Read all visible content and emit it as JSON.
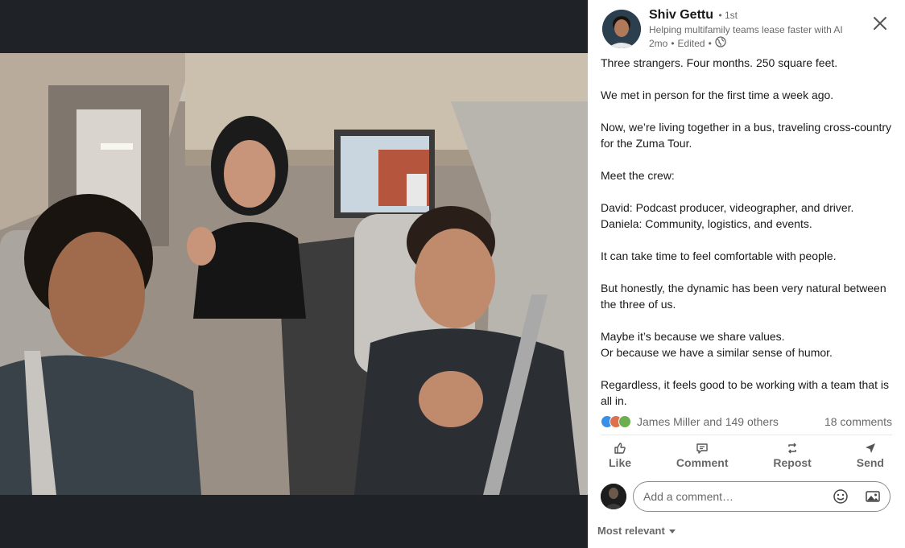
{
  "post": {
    "author": {
      "name": "Shiv Gettu",
      "degree": "• 1st",
      "headline": "Helping multifamily teams lease faster with AI",
      "time": "2mo",
      "edited": "Edited",
      "sep1": "•",
      "sep2": "•"
    },
    "text": {
      "p1": "Three strangers. Four months. 250 square feet.",
      "p2": "We met in person for the first time a week ago.",
      "p3": "Now, we’re living together in a bus, traveling cross-country for the Zuma Tour.",
      "p4": "Meet the crew:",
      "p5a": "David: Podcast producer, videographer, and driver.",
      "p5b": "Daniela: Community, logistics, and events.",
      "p6": "It can take time to feel comfortable with people.",
      "p7": "But honestly, the dynamic has been very natural between the three of us.",
      "p8a": "Maybe it’s because we share values.",
      "p8b": "Or because we have a similar sense of humor.",
      "p9": "Regardless, it feels good to be working with a team that is all in."
    },
    "social": {
      "reactions_text": "James Miller and 149 others",
      "comments": "18 comments"
    },
    "actions": {
      "like": "Like",
      "comment": "Comment",
      "repost": "Repost",
      "send": "Send"
    },
    "comment_box": {
      "placeholder": "Add a comment…"
    },
    "sort": {
      "label": "Most relevant"
    }
  },
  "colors": {
    "viewer_bg": "#1f2227",
    "like_blue": "#378fe9",
    "love_red": "#df704d",
    "celebrate_green": "#6dae4f"
  }
}
